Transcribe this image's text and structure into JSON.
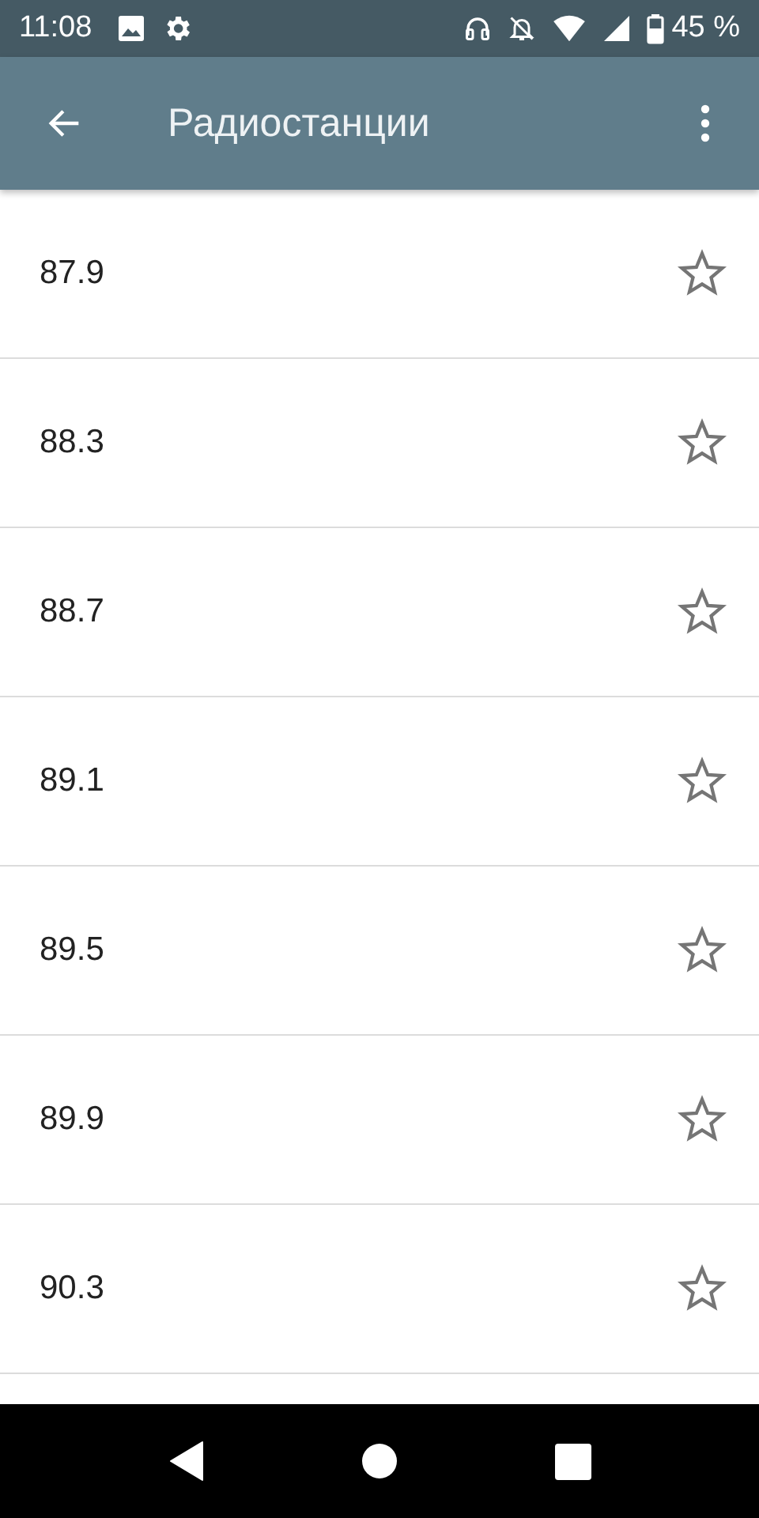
{
  "status_bar": {
    "time": "11:08",
    "battery": "45 %"
  },
  "app_bar": {
    "title": "Радиостанции"
  },
  "stations": [
    {
      "frequency": "87.9",
      "starred": false
    },
    {
      "frequency": "88.3",
      "starred": false
    },
    {
      "frequency": "88.7",
      "starred": false
    },
    {
      "frequency": "89.1",
      "starred": false
    },
    {
      "frequency": "89.5",
      "starred": false
    },
    {
      "frequency": "89.9",
      "starred": false
    },
    {
      "frequency": "90.3",
      "starred": false
    }
  ]
}
